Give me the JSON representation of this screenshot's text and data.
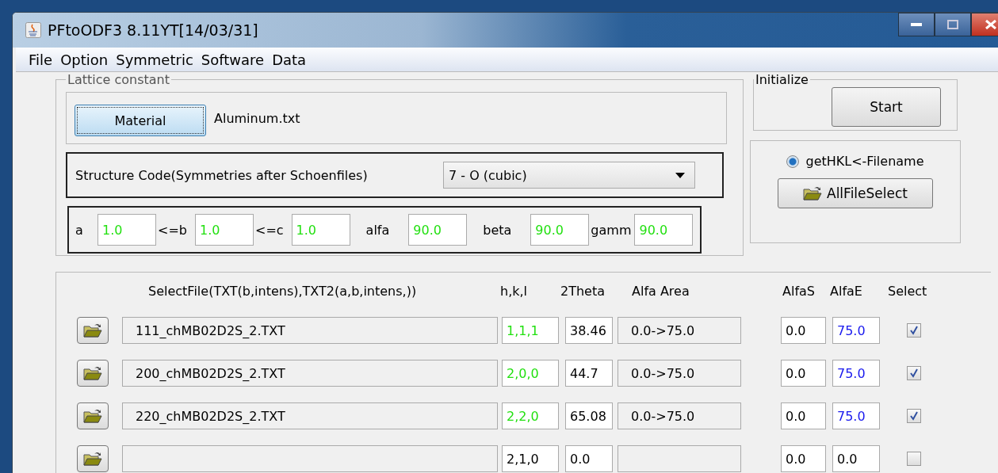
{
  "window": {
    "title": "PFtoODF3 8.11YT[14/03/31]"
  },
  "menu": [
    "File",
    "Option",
    "Symmetric",
    "Software",
    "Data"
  ],
  "lattice": {
    "title": "Lattice constant",
    "material_button": "Material",
    "material_file": "Aluminum.txt",
    "structure_label": "Structure Code(Symmetries after Schoenfiles)",
    "structure_value": "7 - O (cubic)",
    "params": [
      {
        "label": "a",
        "value": "1.0",
        "highlighted": true
      },
      {
        "label": "<=b",
        "value": "1.0",
        "highlighted": true
      },
      {
        "label": "<=c",
        "value": "1.0",
        "highlighted": true
      },
      {
        "label": "alfa",
        "value": "90.0",
        "highlighted": true
      },
      {
        "label": "beta",
        "value": "90.0",
        "highlighted": true
      },
      {
        "label": "gamm",
        "value": "90.0",
        "highlighted": true
      }
    ]
  },
  "initialize": {
    "title": "Initialize",
    "button": "Start"
  },
  "file_source": {
    "radio_label": "getHKL<-Filename",
    "selected": true,
    "button": "AllFileSelect"
  },
  "pf_data": {
    "columns": [
      "SelectFile(TXT(b,intens),TXT2(a,b,intens,))",
      "h,k,l",
      "2Theta",
      "Alfa Area",
      "AlfaS",
      "AlfaE",
      "Select"
    ],
    "rows": [
      {
        "file": "111_chMB02D2S_2.TXT",
        "hkl": "1,1,1",
        "hkl_highlighted": true,
        "two_theta": "38.46",
        "alfa_area": "0.0->75.0",
        "alfa_s": "0.0",
        "alfa_e": "75.0",
        "alfa_e_highlighted": true,
        "checked": true
      },
      {
        "file": "200_chMB02D2S_2.TXT",
        "hkl": "2,0,0",
        "hkl_highlighted": true,
        "two_theta": "44.7",
        "alfa_area": "0.0->75.0",
        "alfa_s": "0.0",
        "alfa_e": "75.0",
        "alfa_e_highlighted": true,
        "checked": true
      },
      {
        "file": "220_chMB02D2S_2.TXT",
        "hkl": "2,2,0",
        "hkl_highlighted": true,
        "two_theta": "65.08",
        "alfa_area": "0.0->75.0",
        "alfa_s": "0.0",
        "alfa_e": "75.0",
        "alfa_e_highlighted": true,
        "checked": true
      },
      {
        "file": "",
        "hkl": "2,1,0",
        "hkl_highlighted": false,
        "two_theta": "0.0",
        "alfa_area": "",
        "alfa_s": "0.0",
        "alfa_e": "0.0",
        "alfa_e_highlighted": false,
        "checked": false
      }
    ]
  }
}
